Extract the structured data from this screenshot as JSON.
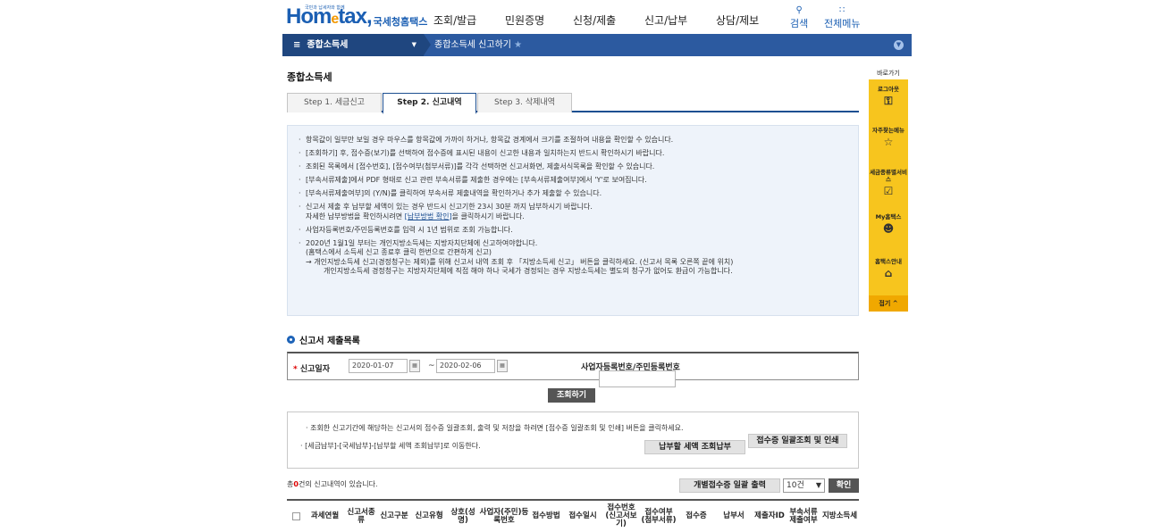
{
  "header": {
    "logo_text": "Hometax",
    "logo_sub": "국세청홈택스",
    "logo_tag": "국민과 납세자와 함께",
    "menu": [
      "조회/발급",
      "민원증명",
      "신청/제출",
      "신고/납부",
      "상담/제보"
    ],
    "util_search": "검색",
    "util_all": "전체메뉴"
  },
  "nav": {
    "level1": "종합소득세",
    "level2": "종합소득세 신고하기"
  },
  "page_title": "종합소득세",
  "tabs": [
    "Step 1. 세금신고",
    "Step 2. 신고내역",
    "Step 3. 삭제내역"
  ],
  "notice": [
    "항목값이 일부만 보일 경우 마우스를 항목값에 가까이 하거나, 항목값 경계에서 크기를 조절하여 내용을 확인할 수 있습니다.",
    "[조회하기] 후, 접수증(보기)를 선택하여 접수증에 표시된 내용이 신고한 내용과 일치하는지 반드시 확인하시기 바랍니다.",
    "조회된 목록에서 [접수번호], [접수여부(첨부서류)]를 각각 선택하면 신고서화면, 제출서식목록을 확인할 수 있습니다.",
    "[부속서류제출]에서 PDF 형태로 신고 관련 부속서류를 제출한 경우에는 [부속서류제출여부]에서 'Y'로 보여집니다.",
    "[부속서류제출여부]의 (Y/N)를 클릭하여 부속서류 제출내역을 확인하거나 추가 제출할 수 있습니다."
  ],
  "notice_pay_1": "신고서 제출 후 납부할 세액이 있는 경우 반드시 신고기한 23시 30분 까지 납부하시기 바랍니다.",
  "notice_pay_2a": "자세한 납부방법을 확인하시려면 ",
  "notice_pay_link": "[납부방법 확인]",
  "notice_pay_2b": "을 클릭하시기 바랍니다.",
  "notice_biz": "사업자등록번호/주민등록번호를 입력 시 1년 범위로 조회 가능합니다.",
  "notice_local": [
    "2020년 1월1일 부터는 개인지방소득세는 지방자치단체에 신고하여야합니다.",
    "(홈택스에서 소득세 신고 종료후 클릭 한번으로 간편하게 신고)",
    "→ 개인지방소득세 신고(경정청구는 제외)를 위해 신고서 내역 조회 후 「지방소득세 신고」 버튼을 클릭하세요. (신고서 목록 오른쪽 끝에 위치)",
    "      개인지방소득세 경정청구는 지방자치단체에 직접 해야 하나 국세가 경정되는 경우 지방소득세는 별도의 청구가 없어도 환급이 가능합니다."
  ],
  "section_title": "신고서 제출목록",
  "search": {
    "date_label": "신고일자",
    "date_from": "2020-01-07",
    "date_to": "2020-02-06",
    "biz_label": "사업자등록번호/주민등록번호",
    "biz_value": "",
    "button": "조회하기"
  },
  "info2": {
    "line1": "· 조회한 신고기간에 해당하는 신고서의 접수증 일괄조회, 출력 및 저장을 하려면 [접수증 일괄조회 및 인쇄] 버튼을 클릭하세요.",
    "line2": "· [세금납부]-[국세납부]-[납부할 세액 조회납부]로 이동한다.",
    "btn_pay": "납부할 세액 조회납부",
    "btn_receipt": "접수증 일괄조회 및 인쇄"
  },
  "list": {
    "count_pre": "총",
    "count": "0",
    "count_post": "건의 신고내역이 있습니다.",
    "btn_print": "개별접수증 일괄 출력",
    "page_size": "10건",
    "btn_ok": "확인",
    "columns": [
      "과세연월",
      "신고서종류",
      "신고구분",
      "신고유형",
      "상호(성명)",
      "사업자(주민)등록번호",
      "접수방법",
      "접수일시",
      "접수번호(신고서보기)",
      "접수여부(첨부서류)",
      "접수증",
      "납부서",
      "제출자ID",
      "부속서류제출여부",
      "지방소득세"
    ]
  },
  "quick": {
    "head": "바로가기",
    "items": [
      "로그아웃",
      "자주찾는메뉴",
      "세금종류별서비스",
      "My홈택스",
      "홈택스안내"
    ],
    "collapse": "접기 ^"
  }
}
